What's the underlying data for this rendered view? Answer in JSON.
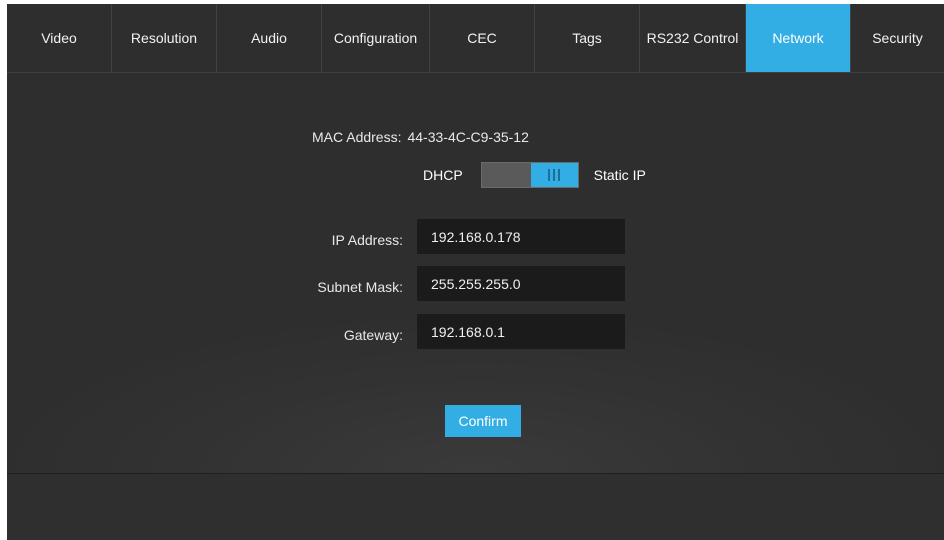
{
  "tabs": [
    {
      "label": "Video",
      "active": false
    },
    {
      "label": "Resolution",
      "active": false
    },
    {
      "label": "Audio",
      "active": false
    },
    {
      "label": "Configuration",
      "active": false
    },
    {
      "label": "CEC",
      "active": false
    },
    {
      "label": "Tags",
      "active": false
    },
    {
      "label": "RS232 Control",
      "active": false
    },
    {
      "label": "Network",
      "active": true
    },
    {
      "label": "Security",
      "active": false
    }
  ],
  "network": {
    "mac_label": "MAC Address:",
    "mac_value": "44-33-4C-C9-35-12",
    "mode_left_label": "DHCP",
    "mode_right_label": "Static IP",
    "mode_selected": "Static IP",
    "toggle_icon": "grip-icon",
    "ip_label": "IP Address:",
    "ip_value": "192.168.0.178",
    "subnet_label": "Subnet Mask:",
    "subnet_value": "255.255.255.0",
    "gateway_label": "Gateway:",
    "gateway_value": "192.168.0.1",
    "confirm_label": "Confirm"
  },
  "colors": {
    "accent": "#33aee5",
    "background": "#2b2b2b",
    "input_background": "#1b1b1b"
  }
}
